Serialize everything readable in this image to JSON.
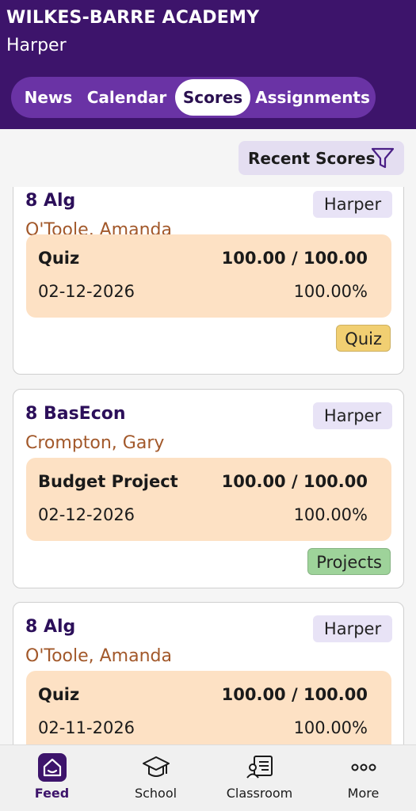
{
  "header": {
    "school": "WILKES-BARRE ACADEMY",
    "student": "Harper",
    "tabs": [
      {
        "label": "News"
      },
      {
        "label": "Calendar"
      },
      {
        "label": "Scores",
        "active": true
      },
      {
        "label": "Assignments"
      }
    ]
  },
  "filter": {
    "label": "Recent Scores",
    "icon": "funnel-icon"
  },
  "cards": [
    {
      "course": "8 Alg",
      "teacher": "O'Toole, Amanda",
      "student": "Harper",
      "item": "Quiz",
      "score": "100.00 / 100.00",
      "date": "02-12-2026",
      "percent": "100.00%",
      "category": "Quiz",
      "category_color": "#f1cf72"
    },
    {
      "course": "8 BasEcon",
      "teacher": "Crompton, Gary",
      "student": "Harper",
      "item": "Budget Project",
      "score": "100.00 / 100.00",
      "date": "02-12-2026",
      "percent": "100.00%",
      "category": "Projects",
      "category_color": "#9ed39a"
    },
    {
      "course": "8 Alg",
      "teacher": "O'Toole, Amanda",
      "student": "Harper",
      "item": "Quiz",
      "score": "100.00 / 100.00",
      "date": "02-11-2026",
      "percent": "100.00%"
    }
  ],
  "bottom_nav": [
    {
      "label": "Feed",
      "icon": "home-icon",
      "active": true
    },
    {
      "label": "School",
      "icon": "graduation-cap-icon"
    },
    {
      "label": "Classroom",
      "icon": "classroom-icon"
    },
    {
      "label": "More",
      "icon": "more-dots-icon"
    }
  ],
  "colors": {
    "header_bg": "#3d146b",
    "tab_bar_bg": "#6a33a5",
    "score_box_bg": "#fde1c4",
    "teacher_text": "#a2582a",
    "course_text": "#2c0f5a"
  }
}
